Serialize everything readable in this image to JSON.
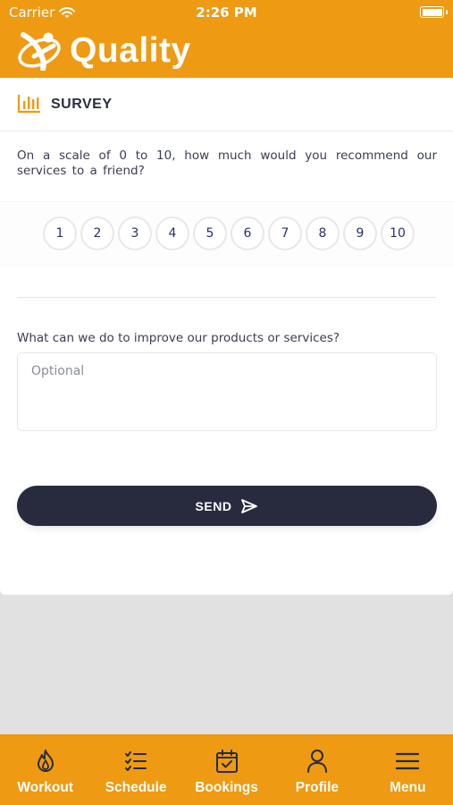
{
  "status_bar": {
    "carrier": "Carrier",
    "time": "2:26 PM",
    "battery_level": 1.0
  },
  "app": {
    "brand_name": "Quality",
    "accent_color": "#ee9a12",
    "dark_color": "#272b3d"
  },
  "survey": {
    "title": "SURVEY",
    "question": "On a scale of 0 to 10, how much would you recommend our services to a friend?",
    "scale": [
      "1",
      "2",
      "3",
      "4",
      "5",
      "6",
      "7",
      "8",
      "9",
      "10"
    ],
    "improve_question": "What can we do to improve our products or services?",
    "improve_placeholder": "Optional",
    "improve_value": "",
    "send_label": "SEND"
  },
  "tabs": [
    {
      "label": "Workout",
      "icon": "flame-icon"
    },
    {
      "label": "Schedule",
      "icon": "checklist-icon"
    },
    {
      "label": "Bookings",
      "icon": "calendar-check-icon"
    },
    {
      "label": "Profile",
      "icon": "person-icon"
    },
    {
      "label": "Menu",
      "icon": "hamburger-menu-icon"
    }
  ]
}
